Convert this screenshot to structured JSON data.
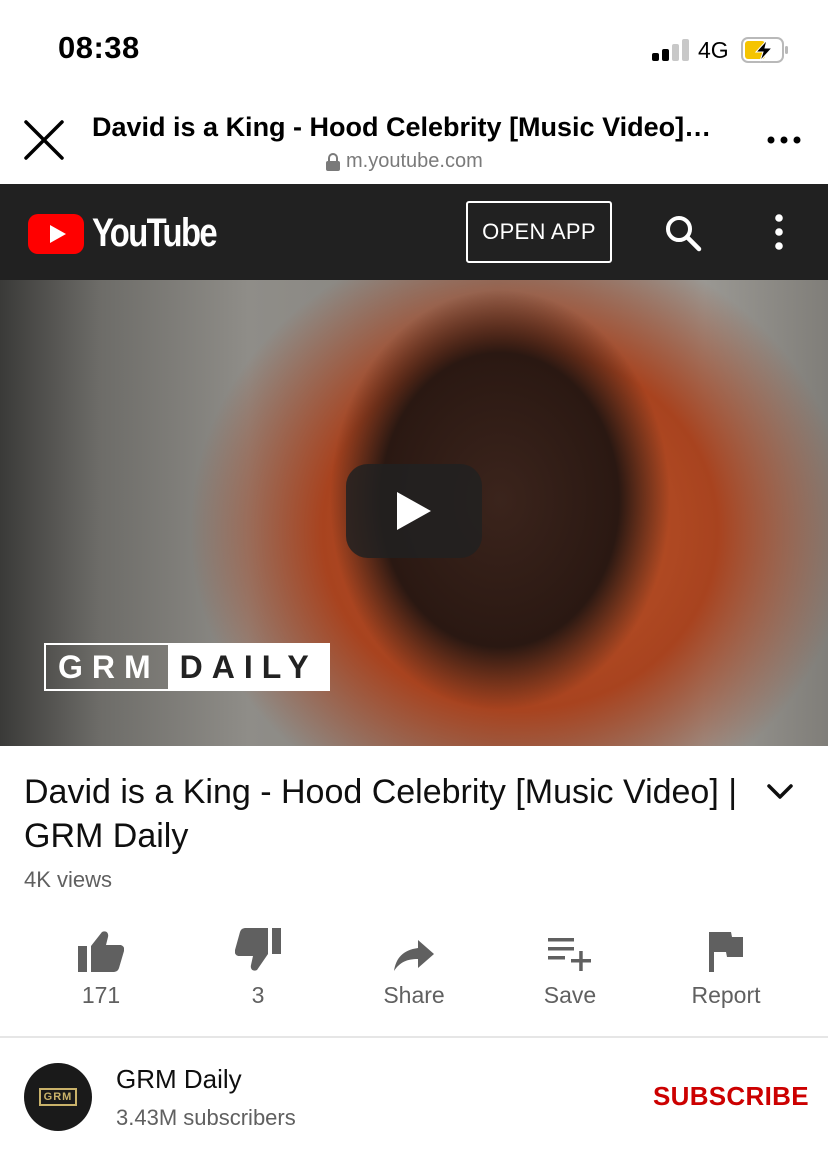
{
  "status_bar": {
    "time": "08:38",
    "network": "4G",
    "icons": [
      "signal-icon",
      "battery-charging-icon"
    ]
  },
  "browser": {
    "page_title": "David is a King - Hood Celebrity [Music Video]…",
    "url": "m.youtube.com",
    "icons": [
      "close-icon",
      "lock-icon",
      "more-icon"
    ]
  },
  "youtube_header": {
    "logo_text": "YouTube",
    "open_app_label": "OPEN APP",
    "accent_color": "#ff0000",
    "icons": [
      "youtube-logo-icon",
      "search-icon",
      "kebab-menu-icon"
    ]
  },
  "video": {
    "watermark_left": "GRM",
    "watermark_right": "DAILY",
    "icons": [
      "play-icon"
    ]
  },
  "info": {
    "title": "David is a King - Hood Celebrity [Music Video] | GRM Daily",
    "views": "4K views",
    "icons": [
      "chevron-down-icon"
    ]
  },
  "actions": {
    "like_count": "171",
    "dislike_count": "3",
    "share_label": "Share",
    "save_label": "Save",
    "report_label": "Report",
    "icons": [
      "thumbs-up-icon",
      "thumbs-down-icon",
      "share-icon",
      "playlist-add-icon",
      "flag-icon"
    ]
  },
  "channel": {
    "avatar_text": "GRM",
    "name": "GRM Daily",
    "subscribers": "3.43M subscribers",
    "subscribe_label": "SUBSCRIBE",
    "subscribe_color": "#cc0000"
  }
}
